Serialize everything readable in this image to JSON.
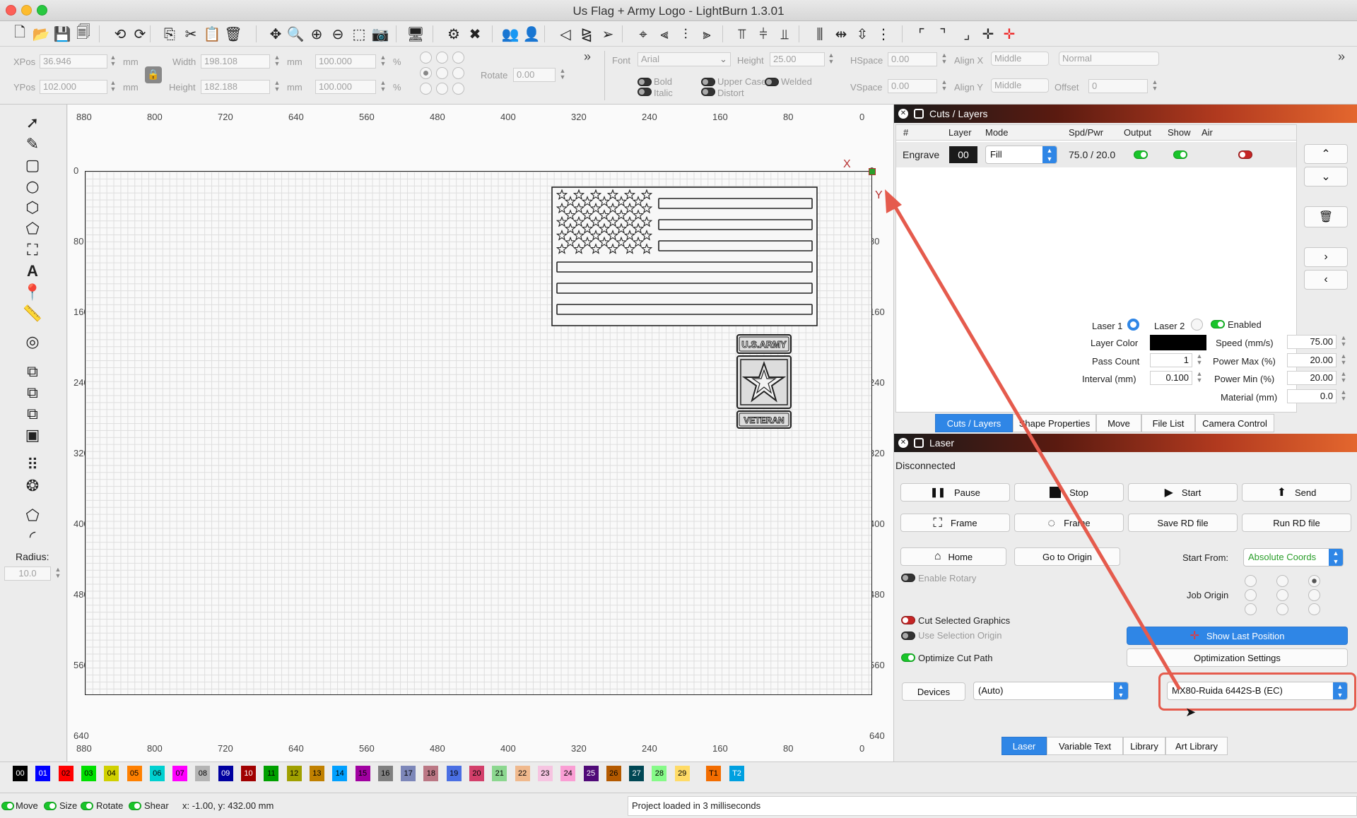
{
  "window": {
    "title": "Us Flag + Army Logo - LightBurn 1.3.01"
  },
  "toolbar1": {
    "icons": [
      "new-file-icon",
      "open-file-icon",
      "save-icon",
      "save-as-icon",
      "undo-icon",
      "redo-icon",
      "copy-icon",
      "cut-icon",
      "paste-icon",
      "delete-icon",
      "move-icon",
      "zoom-icon",
      "zoom-in-icon",
      "zoom-out-icon",
      "select-frame-icon",
      "camera-icon",
      "monitor-icon",
      "settings-icon",
      "tools-icon",
      "group-icon",
      "user-icon",
      "mirror-icon",
      "flip-icon",
      "send-icon",
      "target-icon",
      "align-left-icon",
      "align-center-icon",
      "align-right-icon",
      "align-top-icon",
      "align-middle-icon",
      "align-bottom-icon",
      "distribute-icon",
      "distribute-h-icon",
      "distribute-v-icon",
      "distribute-equal-icon",
      "corner-icon",
      "corner2-icon",
      "corner3-icon",
      "crosshair-icon",
      "red-crosshair-icon"
    ]
  },
  "position": {
    "xpos_label": "XPos",
    "xpos_value": "36.946",
    "ypos_label": "YPos",
    "ypos_value": "102.000",
    "unit": "mm",
    "width_label": "Width",
    "width_value": "198.108",
    "height_label": "Height",
    "height_value": "182.188",
    "w_percent": "100.000",
    "h_percent": "100.000",
    "percent": "%",
    "rotate_label": "Rotate",
    "rotate_value": "0.00"
  },
  "font": {
    "font_label": "Font",
    "font_value": "Arial",
    "height_label": "Height",
    "height_value": "25.00",
    "hspace_label": "HSpace",
    "hspace_value": "0.00",
    "vspace_label": "VSpace",
    "vspace_value": "0.00",
    "alignx_label": "Align X",
    "alignx_value": "Middle",
    "aligny_label": "Align Y",
    "aligny_value": "Middle",
    "style_value": "Normal",
    "offset_label": "Offset",
    "offset_value": "0",
    "bold": "Bold",
    "italic": "Italic",
    "upper": "Upper Case",
    "welded": "Welded",
    "distort": "Distort"
  },
  "ruler": {
    "x_ticks": [
      "880",
      "800",
      "720",
      "640",
      "560",
      "480",
      "400",
      "320",
      "240",
      "160",
      "80",
      "0"
    ],
    "y_ticks": [
      "0",
      "80",
      "160",
      "240",
      "320",
      "400",
      "480",
      "560",
      "640"
    ],
    "x_marker": "X",
    "y_marker": "Y"
  },
  "tools": {
    "radius_label": "Radius:",
    "radius_value": "10.0"
  },
  "flag": {
    "army_top": "U.S.ARMY",
    "army_bottom": "VETERAN"
  },
  "cuts": {
    "title": "Cuts / Layers",
    "headers": [
      "#",
      "Layer",
      "Mode",
      "Spd/Pwr",
      "Output",
      "Show",
      "Air"
    ],
    "row": {
      "name": "Engrave",
      "layer": "00",
      "mode": "Fill",
      "spdpwr": "75.0 / 20.0"
    },
    "laser1": "Laser 1",
    "laser2": "Laser 2",
    "enabled": "Enabled",
    "layer_color_label": "Layer Color",
    "pass_count_label": "Pass Count",
    "pass_count_value": "1",
    "interval_label": "Interval (mm)",
    "interval_value": "0.100",
    "speed_label": "Speed (mm/s)",
    "speed_value": "75.00",
    "pmax_label": "Power Max (%)",
    "pmax_value": "20.00",
    "pmin_label": "Power Min (%)",
    "pmin_value": "20.00",
    "material_label": "Material (mm)",
    "material_value": "0.0",
    "tabs": [
      "Cuts / Layers",
      "Shape Properties",
      "Move",
      "File List",
      "Camera Control"
    ]
  },
  "laser": {
    "title": "Laser",
    "status": "Disconnected",
    "pause": "Pause",
    "stop": "Stop",
    "start": "Start",
    "send": "Send",
    "frame1": "Frame",
    "frame2": "Frame",
    "save_rd": "Save RD file",
    "run_rd": "Run RD file",
    "home": "Home",
    "go_origin": "Go to Origin",
    "start_from_label": "Start From:",
    "start_from_value": "Absolute Coords",
    "enable_rotary": "Enable Rotary",
    "job_origin": "Job Origin",
    "cut_selected": "Cut Selected Graphics",
    "use_selection_origin": "Use Selection Origin",
    "optimize": "Optimize Cut Path",
    "show_last": "Show Last Position",
    "opt_settings": "Optimization Settings",
    "devices": "Devices",
    "port_value": "(Auto)",
    "device_value": "MX80-Ruida 6442S-B (EC)",
    "tabs": [
      "Laser",
      "Variable Text",
      "Library",
      "Art Library"
    ]
  },
  "palette": {
    "items": [
      "00",
      "01",
      "02",
      "03",
      "04",
      "05",
      "06",
      "07",
      "08",
      "09",
      "10",
      "11",
      "12",
      "13",
      "14",
      "15",
      "16",
      "17",
      "18",
      "19",
      "20",
      "21",
      "22",
      "23",
      "24",
      "25",
      "26",
      "27",
      "28",
      "29",
      "T1",
      "T2"
    ],
    "colors": [
      "#000000",
      "#0000ff",
      "#ff0000",
      "#00e000",
      "#d0d000",
      "#ff8000",
      "#00d0d0",
      "#ff00ff",
      "#b4b4b4",
      "#0000a0",
      "#a00000",
      "#00a000",
      "#a0a000",
      "#c08000",
      "#00a0ff",
      "#a000a0",
      "#808080",
      "#7d87b9",
      "#bb7784",
      "#4a6fe3",
      "#d33f6a",
      "#8cd78f",
      "#f0b98d",
      "#f6c4e1",
      "#fa9ed4",
      "#500a78",
      "#b45a00",
      "#004754",
      "#86fa88",
      "#ffdb66",
      "#f36d00",
      "#00a0e0"
    ],
    "text_light": [
      "00",
      "01",
      "09",
      "10",
      "25",
      "27",
      "T2"
    ]
  },
  "status": {
    "move": "Move",
    "size": "Size",
    "rotate": "Rotate",
    "shear": "Shear",
    "coords": "x: -1.00, y: 432.00 mm",
    "message": "Project loaded in 3 milliseconds"
  }
}
